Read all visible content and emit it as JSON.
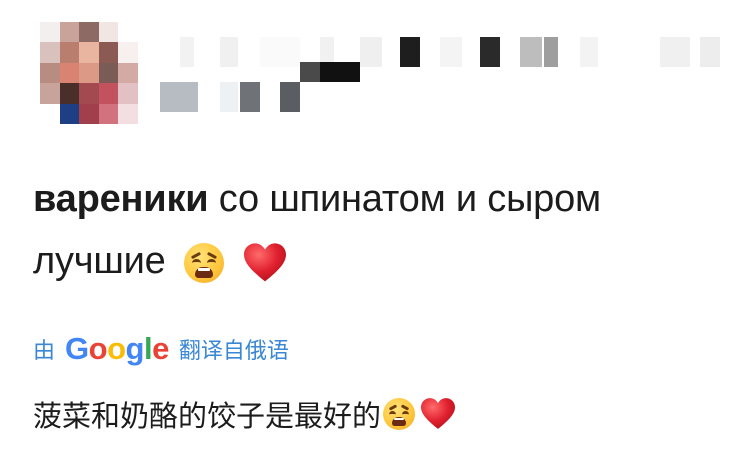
{
  "comment": {
    "bold_word": "вареники",
    "rest_line1": " со шпинатом и сыром",
    "line2": "лучшие",
    "emojis": [
      "weary-face-icon",
      "red-heart-icon"
    ]
  },
  "translation_credit": {
    "prefix": "由",
    "provider": "Google",
    "suffix": "翻译自俄语"
  },
  "translation": {
    "text": "菠菜和奶酪的饺子是最好的",
    "emojis": [
      "weary-face-icon",
      "red-heart-icon"
    ]
  },
  "colors": {
    "link_blue": "#3a87d6",
    "heart_red": "#e0202e",
    "google_blue": "#4285f4",
    "google_red": "#ea4335",
    "google_yellow": "#fbbc05",
    "google_green": "#34a853"
  }
}
